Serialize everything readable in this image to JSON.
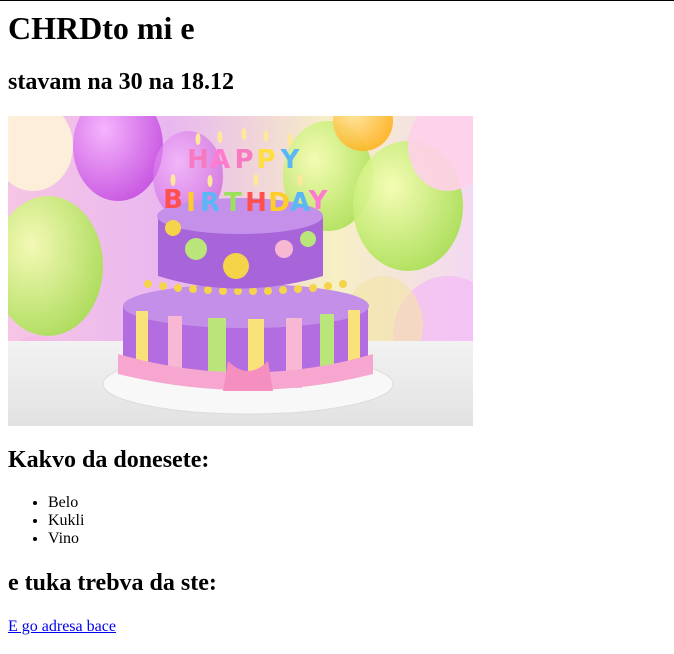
{
  "page": {
    "title": "CHRDto mi e",
    "subtitle": "stavam na 30 na 18.12",
    "image": {
      "alt": "birthday-cake",
      "cake_topper_text": "HAPPY BIRTHDAY"
    },
    "bring_heading": "Kakvo da donesete:",
    "bring_items": [
      "Belo",
      "Kukli",
      "Vino"
    ],
    "place_heading": "e tuka trebva da ste:",
    "address_link": "E go adresa bace"
  },
  "colors": {
    "link": "#0000ee",
    "text": "#000000",
    "background": "#ffffff"
  }
}
